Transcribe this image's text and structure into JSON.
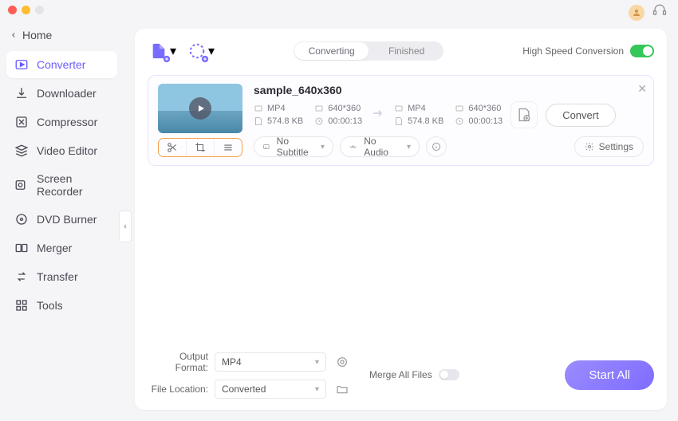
{
  "home_label": "Home",
  "sidebar": [
    {
      "label": "Converter",
      "icon": "converter"
    },
    {
      "label": "Downloader",
      "icon": "download"
    },
    {
      "label": "Compressor",
      "icon": "compress"
    },
    {
      "label": "Video Editor",
      "icon": "editor"
    },
    {
      "label": "Screen Recorder",
      "icon": "recorder"
    },
    {
      "label": "DVD Burner",
      "icon": "dvd"
    },
    {
      "label": "Merger",
      "icon": "merger"
    },
    {
      "label": "Transfer",
      "icon": "transfer"
    },
    {
      "label": "Tools",
      "icon": "tools"
    }
  ],
  "tabs": {
    "converting": "Converting",
    "finished": "Finished"
  },
  "high_speed_label": "High Speed Conversion",
  "file": {
    "name": "sample_640x360",
    "src": {
      "format": "MP4",
      "resolution": "640*360",
      "size": "574.8 KB",
      "duration": "00:00:13"
    },
    "dst": {
      "format": "MP4",
      "resolution": "640*360",
      "size": "574.8 KB",
      "duration": "00:00:13"
    },
    "subtitle": "No Subtitle",
    "audio": "No Audio",
    "settings_label": "Settings",
    "convert_label": "Convert"
  },
  "footer": {
    "output_format_label": "Output Format:",
    "output_format_value": "MP4",
    "file_location_label": "File Location:",
    "file_location_value": "Converted",
    "merge_label": "Merge All Files",
    "start_all_label": "Start All"
  }
}
